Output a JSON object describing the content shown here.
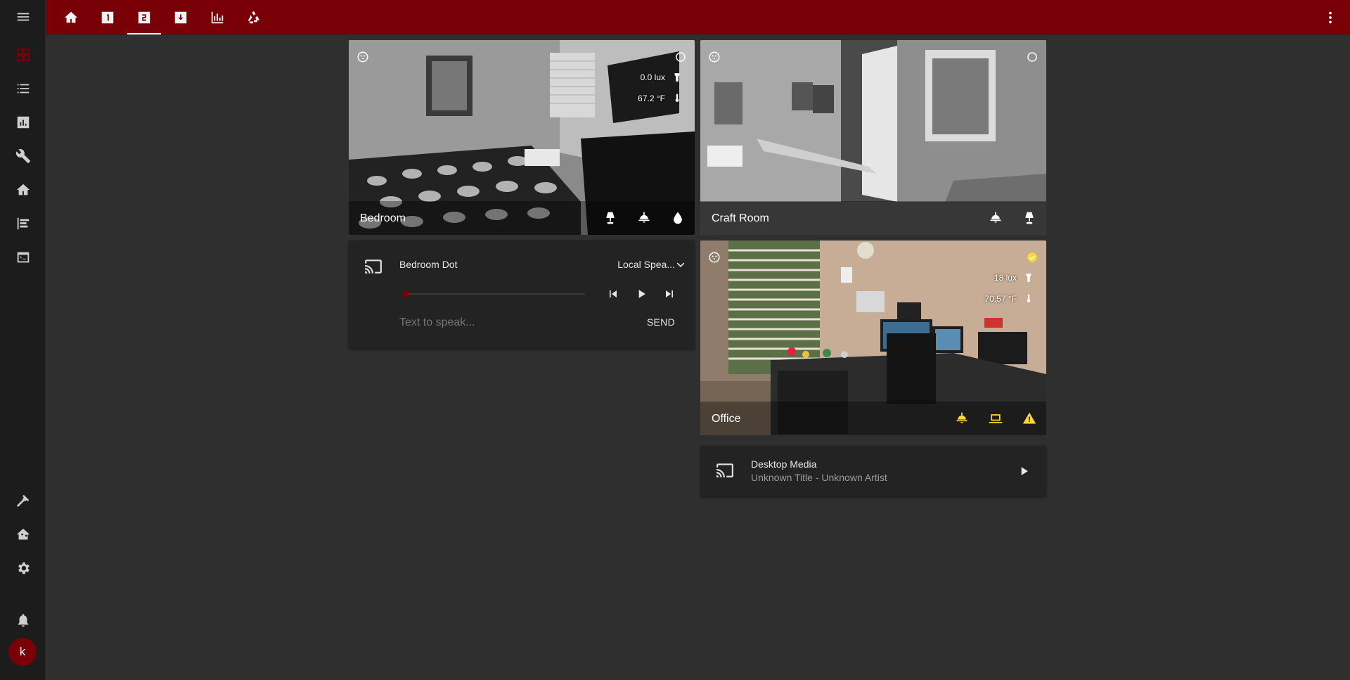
{
  "colors": {
    "accent": "#7a0008",
    "on": "#fdd835",
    "bg": "#2f2f2f",
    "sidebar": "#1c1c1c"
  },
  "sidebar": {
    "items": [
      {
        "name": "overview-icon"
      },
      {
        "name": "logbook-icon"
      },
      {
        "name": "history-icon"
      },
      {
        "name": "wrench-icon"
      },
      {
        "name": "home-icon"
      },
      {
        "name": "grid-icon"
      },
      {
        "name": "terminal-icon"
      }
    ],
    "bottom": [
      {
        "name": "hammer-icon"
      },
      {
        "name": "home-assistant-icon"
      },
      {
        "name": "gear-icon"
      },
      {
        "name": "bell-icon"
      }
    ],
    "avatar": "k"
  },
  "topbar": {
    "tabs": [
      {
        "icon": "home-icon"
      },
      {
        "icon": "numeric-1-box-icon"
      },
      {
        "icon": "numeric-2-box-icon",
        "active": true
      },
      {
        "icon": "download-box-icon"
      },
      {
        "icon": "bar-chart-icon"
      },
      {
        "icon": "recycle-icon"
      }
    ]
  },
  "cards": {
    "bedroom": {
      "title": "Bedroom",
      "lux": "0.0 lux",
      "temp": "67.2 °F",
      "footer_icons": [
        "lamp-icon",
        "ceiling-light-icon",
        "water-icon"
      ]
    },
    "craft_room": {
      "title": "Craft Room",
      "footer_icons": [
        "ceiling-light-icon",
        "lamp-icon"
      ]
    },
    "office": {
      "title": "Office",
      "lux": "18 lux",
      "temp": "70.57 °F",
      "footer_icons": [
        "ceiling-light-icon",
        "laptop-icon",
        "alert-icon"
      ]
    }
  },
  "media_bedroom": {
    "name": "Bedroom Dot",
    "source": "Local Spea...",
    "tts_placeholder": "Text to speak...",
    "send_label": "SEND",
    "progress": 0
  },
  "media_desktop": {
    "name": "Desktop Media",
    "subtitle": "Unknown Title - Unknown Artist"
  }
}
